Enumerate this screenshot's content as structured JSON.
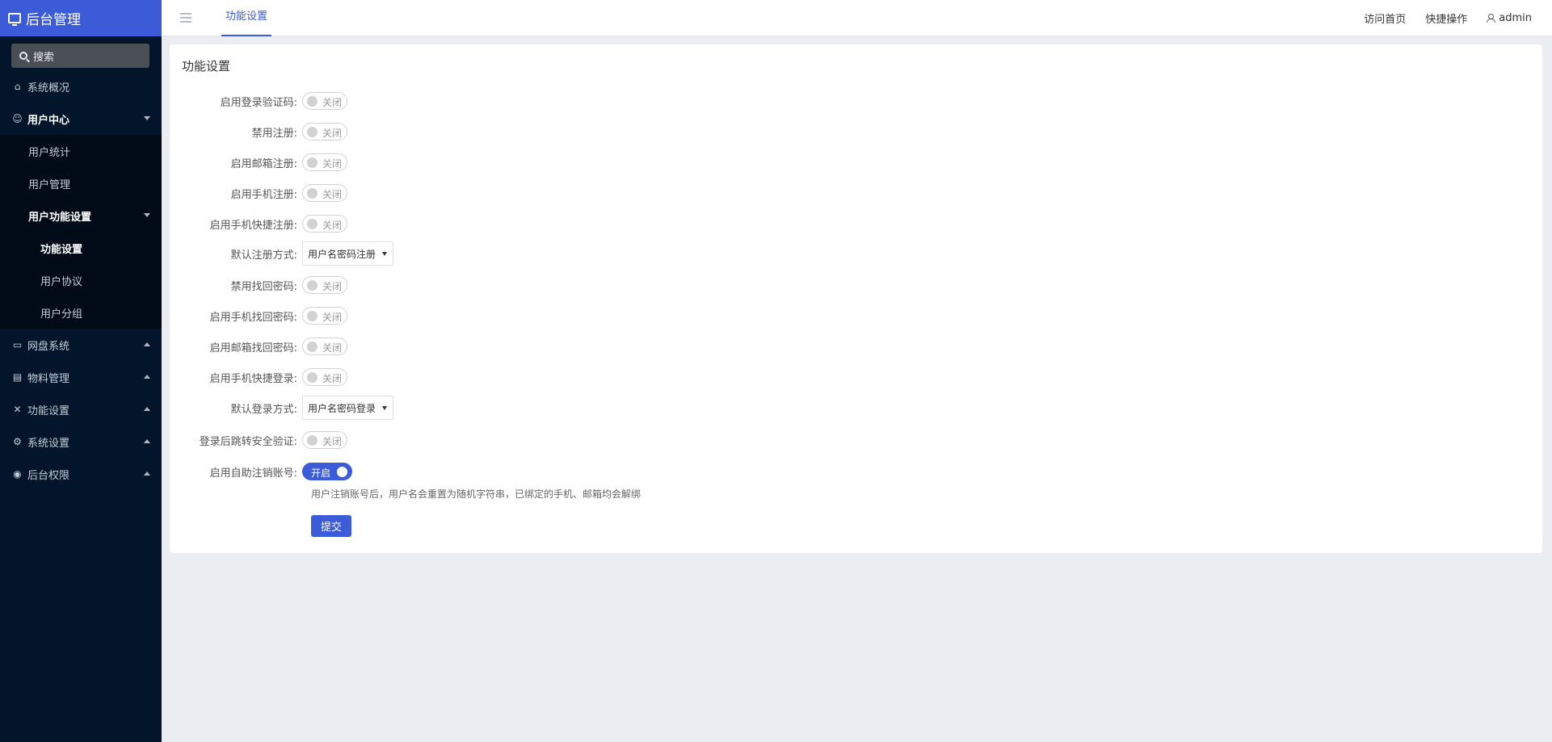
{
  "app": {
    "title": "后台管理"
  },
  "search": {
    "placeholder": "搜索"
  },
  "sidebar": {
    "items": [
      {
        "label": "系统概况",
        "icon": "home-icon"
      },
      {
        "label": "用户中心",
        "icon": "users-icon",
        "expanded": true
      },
      {
        "label": "用户统计"
      },
      {
        "label": "用户管理"
      },
      {
        "label": "用户功能设置",
        "expanded": true
      },
      {
        "label": "功能设置",
        "current": true
      },
      {
        "label": "用户协议"
      },
      {
        "label": "用户分组"
      },
      {
        "label": "网盘系统",
        "icon": "folder-icon"
      },
      {
        "label": "物料管理",
        "icon": "list-icon"
      },
      {
        "label": "功能设置",
        "icon": "tools-icon"
      },
      {
        "label": "系统设置",
        "icon": "gear-icon"
      },
      {
        "label": "后台权限",
        "icon": "user-circle-icon"
      }
    ]
  },
  "topbar": {
    "tab": "功能设置",
    "links": [
      "访问首页",
      "快捷操作"
    ],
    "user": "admin"
  },
  "card": {
    "title": "功能设置"
  },
  "form": {
    "rows": [
      {
        "label": "启用登录验证码:",
        "type": "switch",
        "state": "关闭"
      },
      {
        "label": "禁用注册:",
        "type": "switch",
        "state": "关闭"
      },
      {
        "label": "启用邮箱注册:",
        "type": "switch",
        "state": "关闭"
      },
      {
        "label": "启用手机注册:",
        "type": "switch",
        "state": "关闭"
      },
      {
        "label": "启用手机快捷注册:",
        "type": "switch",
        "state": "关闭"
      },
      {
        "label": "默认注册方式:",
        "type": "select",
        "value": "用户名密码注册"
      },
      {
        "label": "禁用找回密码:",
        "type": "switch",
        "state": "关闭"
      },
      {
        "label": "启用手机找回密码:",
        "type": "switch",
        "state": "关闭"
      },
      {
        "label": "启用邮箱找回密码:",
        "type": "switch",
        "state": "关闭"
      },
      {
        "label": "启用手机快捷登录:",
        "type": "switch",
        "state": "关闭"
      },
      {
        "label": "默认登录方式:",
        "type": "select",
        "value": "用户名密码登录"
      },
      {
        "label": "登录后跳转安全验证:",
        "type": "switch",
        "state": "关闭"
      },
      {
        "label": "启用自助注销账号:",
        "type": "switch",
        "state": "开启",
        "on": true
      }
    ],
    "hint": "用户注销账号后，用户名会重置为随机字符串，已绑定的手机、邮箱均会解绑",
    "submit": "提交"
  },
  "colors": {
    "brand": "#3b5bd9",
    "sidebar": "#03152a"
  }
}
